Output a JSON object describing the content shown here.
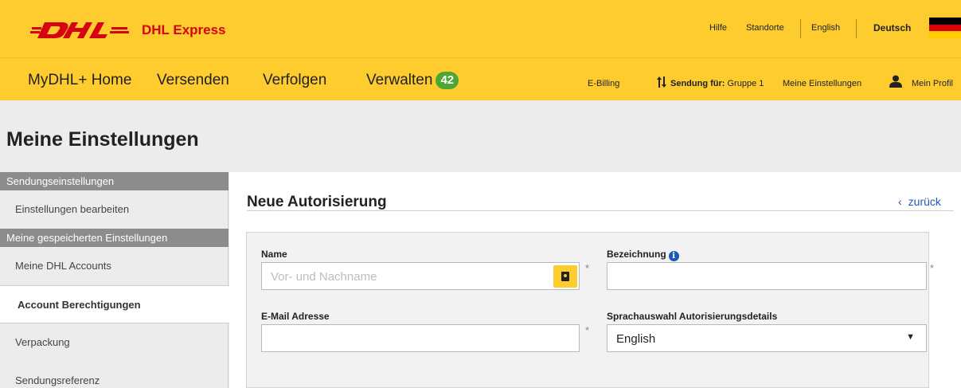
{
  "header": {
    "brand": "DHL Express",
    "logo_text": "DHL",
    "util_links": [
      "Hilfe",
      "Standorte",
      "English",
      "Deutsch"
    ],
    "brand_color": "#d40511",
    "bar_color": "#fecc2f"
  },
  "nav": {
    "items": [
      "MyDHL+ Home",
      "Versenden",
      "Verfolgen",
      "Verwalten"
    ],
    "manage_badge": "42",
    "billing": "E-Billing",
    "shipment_for_label": "Sendung für:",
    "shipment_for_value": "Gruppe 1",
    "settings": "Meine Einstellungen",
    "profile": "Mein Profil"
  },
  "page": {
    "title": "Meine Einstellungen"
  },
  "sidebar": {
    "sections": [
      {
        "heading": "Sendungseinstellungen",
        "items": [
          "Einstellungen bearbeiten"
        ]
      },
      {
        "heading": "Meine gespeicherten Einstellungen",
        "items": [
          "Meine DHL Accounts",
          "Account Berechtigungen",
          "Verpackung",
          "Sendungsreferenz"
        ]
      }
    ],
    "active_item": "Account Berechtigungen"
  },
  "form": {
    "title": "Neue Autorisierung",
    "back_label": "zurück",
    "name_label": "Name",
    "name_placeholder": "Vor- und Nachname",
    "designation_label": "Bezeichnung",
    "email_label": "E-Mail Adresse",
    "language_label": "Sprachauswahl Autorisierungsdetails",
    "language_value": "English",
    "required_marker": "*"
  }
}
